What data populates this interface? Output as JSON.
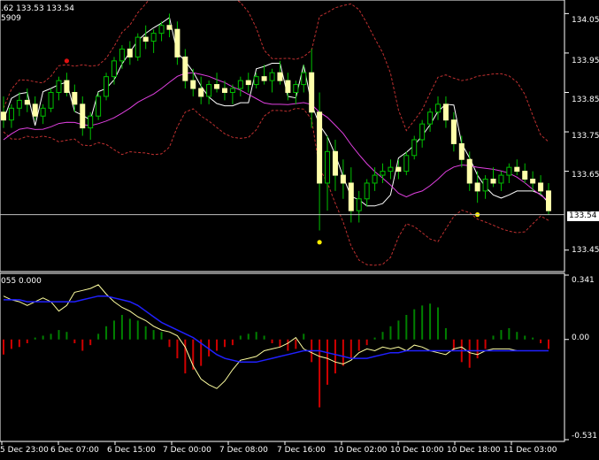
{
  "header": {
    "main_line1": ".62 133.53 133.54",
    "main_line2": "5909",
    "sub_line1": "055 0.000"
  },
  "colors": {
    "background": "#000000",
    "axis": "#ffffff",
    "bull_candle": "#00c000",
    "bear_candle": "#ffffaa",
    "bands": "#c03030",
    "ma_white": "#ffffff",
    "ma_magenta": "#e040e0",
    "dot_red": "#e01010",
    "dot_yellow": "#ffee00",
    "hist_green": "#008000",
    "hist_red": "#d00000",
    "osc_yellow": "#ffffa0",
    "osc_blue": "#2020ff"
  },
  "price_axis": {
    "labels": [
      "134.05",
      "133.95",
      "133.85",
      "133.75",
      "133.65",
      "133.45"
    ],
    "current_price": "133.54"
  },
  "osc_axis": {
    "labels": [
      "0.341",
      "0.00",
      "-0.531"
    ]
  },
  "time_axis": {
    "labels": [
      "5 Dec 23:00",
      "6 Dec 07:00",
      "6 Dec 15:00",
      "7 Dec 00:00",
      "7 Dec 08:00",
      "7 Dec 16:00",
      "10 Dec 02:00",
      "10 Dec 10:00",
      "10 Dec 18:00",
      "11 Dec 03:00"
    ]
  },
  "chart_data": [
    {
      "type": "candlestick",
      "pane": "price",
      "ylim": [
        133.4,
        134.08
      ],
      "current_price": 133.54,
      "candles": [
        [
          133.8,
          133.84,
          133.76,
          133.78
        ],
        [
          133.78,
          133.82,
          133.76,
          133.81
        ],
        [
          133.81,
          133.85,
          133.79,
          133.83
        ],
        [
          133.83,
          133.86,
          133.8,
          133.82
        ],
        [
          133.82,
          133.84,
          133.78,
          133.79
        ],
        [
          133.79,
          133.82,
          133.77,
          133.81
        ],
        [
          133.81,
          133.86,
          133.8,
          133.85
        ],
        [
          133.85,
          133.89,
          133.83,
          133.88
        ],
        [
          133.88,
          133.9,
          133.84,
          133.85
        ],
        [
          133.85,
          133.87,
          133.8,
          133.82
        ],
        [
          133.82,
          133.84,
          133.74,
          133.76
        ],
        [
          133.76,
          133.8,
          133.73,
          133.79
        ],
        [
          133.79,
          133.85,
          133.78,
          133.84
        ],
        [
          133.84,
          133.9,
          133.83,
          133.89
        ],
        [
          133.89,
          133.94,
          133.87,
          133.93
        ],
        [
          133.93,
          133.97,
          133.91,
          133.96
        ],
        [
          133.96,
          133.98,
          133.92,
          133.94
        ],
        [
          133.94,
          134.0,
          133.93,
          133.99
        ],
        [
          133.99,
          134.02,
          133.96,
          133.98
        ],
        [
          133.98,
          134.01,
          133.95,
          134.0
        ],
        [
          134.0,
          134.03,
          133.98,
          134.02
        ],
        [
          134.02,
          134.05,
          133.99,
          134.01
        ],
        [
          134.01,
          134.03,
          133.92,
          133.94
        ],
        [
          133.94,
          133.96,
          133.86,
          133.88
        ],
        [
          133.88,
          133.91,
          133.84,
          133.86
        ],
        [
          133.86,
          133.89,
          133.82,
          133.84
        ],
        [
          133.84,
          133.88,
          133.82,
          133.87
        ],
        [
          133.87,
          133.9,
          133.85,
          133.86
        ],
        [
          133.86,
          133.88,
          133.83,
          133.85
        ],
        [
          133.85,
          133.87,
          133.82,
          133.86
        ],
        [
          133.86,
          133.89,
          133.84,
          133.88
        ],
        [
          133.88,
          133.9,
          133.85,
          133.87
        ],
        [
          133.87,
          133.9,
          133.86,
          133.89
        ],
        [
          133.89,
          133.92,
          133.87,
          133.88
        ],
        [
          133.88,
          133.91,
          133.85,
          133.9
        ],
        [
          133.9,
          133.93,
          133.87,
          133.88
        ],
        [
          133.88,
          133.9,
          133.83,
          133.85
        ],
        [
          133.85,
          133.88,
          133.82,
          133.87
        ],
        [
          133.87,
          133.92,
          133.85,
          133.9
        ],
        [
          133.9,
          133.96,
          133.76,
          133.8
        ],
        [
          133.8,
          133.85,
          133.5,
          133.62
        ],
        [
          133.62,
          133.74,
          133.55,
          133.7
        ],
        [
          133.7,
          133.73,
          133.6,
          133.64
        ],
        [
          133.64,
          133.68,
          133.58,
          133.62
        ],
        [
          133.62,
          133.66,
          133.52,
          133.55
        ],
        [
          133.55,
          133.6,
          133.52,
          133.58
        ],
        [
          133.58,
          133.63,
          133.56,
          133.62
        ],
        [
          133.62,
          133.66,
          133.6,
          133.64
        ],
        [
          133.64,
          133.67,
          133.62,
          133.65
        ],
        [
          133.65,
          133.68,
          133.63,
          133.66
        ],
        [
          133.66,
          133.68,
          133.63,
          133.65
        ],
        [
          133.65,
          133.7,
          133.64,
          133.69
        ],
        [
          133.69,
          133.74,
          133.68,
          133.73
        ],
        [
          133.73,
          133.78,
          133.71,
          133.77
        ],
        [
          133.77,
          133.81,
          133.75,
          133.8
        ],
        [
          133.8,
          133.84,
          133.78,
          133.82
        ],
        [
          133.82,
          133.84,
          133.76,
          133.78
        ],
        [
          133.78,
          133.8,
          133.7,
          133.72
        ],
        [
          133.72,
          133.74,
          133.66,
          133.68
        ],
        [
          133.68,
          133.7,
          133.6,
          133.62
        ],
        [
          133.62,
          133.65,
          133.57,
          133.6
        ],
        [
          133.6,
          133.64,
          133.58,
          133.63
        ],
        [
          133.63,
          133.66,
          133.61,
          133.62
        ],
        [
          133.62,
          133.65,
          133.6,
          133.64
        ],
        [
          133.64,
          133.67,
          133.62,
          133.66
        ],
        [
          133.66,
          133.68,
          133.64,
          133.65
        ],
        [
          133.65,
          133.67,
          133.62,
          133.63
        ],
        [
          133.63,
          133.65,
          133.6,
          133.62
        ],
        [
          133.62,
          133.64,
          133.59,
          133.6
        ],
        [
          133.6,
          133.62,
          133.54,
          133.55
        ]
      ]
    },
    {
      "type": "histogram",
      "pane": "oscillator",
      "ylim": [
        -0.531,
        0.341
      ],
      "values": [
        -0.08,
        -0.05,
        -0.04,
        -0.02,
        0.01,
        0.02,
        0.03,
        0.05,
        0.04,
        -0.02,
        -0.06,
        -0.03,
        0.03,
        0.07,
        0.1,
        0.13,
        0.11,
        0.1,
        0.07,
        0.05,
        0.04,
        -0.04,
        -0.1,
        -0.18,
        -0.16,
        -0.14,
        -0.09,
        -0.06,
        -0.04,
        -0.03,
        0.02,
        0.03,
        0.04,
        0.02,
        -0.02,
        -0.04,
        -0.06,
        -0.05,
        0.03,
        -0.12,
        -0.36,
        -0.24,
        -0.18,
        -0.14,
        -0.1,
        -0.06,
        -0.03,
        0.01,
        0.04,
        0.07,
        0.1,
        0.13,
        0.16,
        0.18,
        0.19,
        0.17,
        0.06,
        -0.06,
        -0.12,
        -0.15,
        -0.1,
        -0.05,
        0.02,
        0.05,
        0.06,
        0.04,
        0.02,
        0.01,
        -0.02,
        -0.05
      ],
      "signal_yellow": [
        0.23,
        0.21,
        0.2,
        0.18,
        0.2,
        0.22,
        0.2,
        0.15,
        0.18,
        0.25,
        0.26,
        0.27,
        0.29,
        0.24,
        0.2,
        0.17,
        0.15,
        0.12,
        0.1,
        0.07,
        0.05,
        0.04,
        0.02,
        -0.04,
        -0.14,
        -0.21,
        -0.24,
        -0.26,
        -0.22,
        -0.16,
        -0.11,
        -0.1,
        -0.09,
        -0.06,
        -0.05,
        -0.04,
        -0.02,
        0.01,
        -0.05,
        -0.07,
        -0.09,
        -0.1,
        -0.12,
        -0.13,
        -0.11,
        -0.07,
        -0.05,
        -0.06,
        -0.04,
        -0.05,
        -0.04,
        -0.06,
        -0.03,
        -0.04,
        -0.06,
        -0.07,
        -0.08,
        -0.05,
        -0.04,
        -0.07,
        -0.08,
        -0.06,
        -0.05,
        -0.05,
        -0.05,
        -0.06,
        -0.06,
        -0.06,
        -0.06,
        -0.06
      ],
      "signal_blue": [
        0.21,
        0.21,
        0.21,
        0.2,
        0.2,
        0.2,
        0.2,
        0.2,
        0.2,
        0.2,
        0.21,
        0.22,
        0.23,
        0.23,
        0.22,
        0.21,
        0.2,
        0.18,
        0.15,
        0.12,
        0.09,
        0.07,
        0.05,
        0.03,
        0.01,
        -0.02,
        -0.05,
        -0.08,
        -0.1,
        -0.11,
        -0.12,
        -0.12,
        -0.12,
        -0.11,
        -0.1,
        -0.09,
        -0.08,
        -0.07,
        -0.06,
        -0.06,
        -0.06,
        -0.07,
        -0.08,
        -0.09,
        -0.1,
        -0.1,
        -0.1,
        -0.09,
        -0.08,
        -0.07,
        -0.07,
        -0.06,
        -0.06,
        -0.06,
        -0.06,
        -0.06,
        -0.06,
        -0.06,
        -0.06,
        -0.06,
        -0.06,
        -0.06,
        -0.06,
        -0.06,
        -0.06,
        -0.06,
        -0.06,
        -0.06,
        -0.06,
        -0.06
      ]
    }
  ]
}
